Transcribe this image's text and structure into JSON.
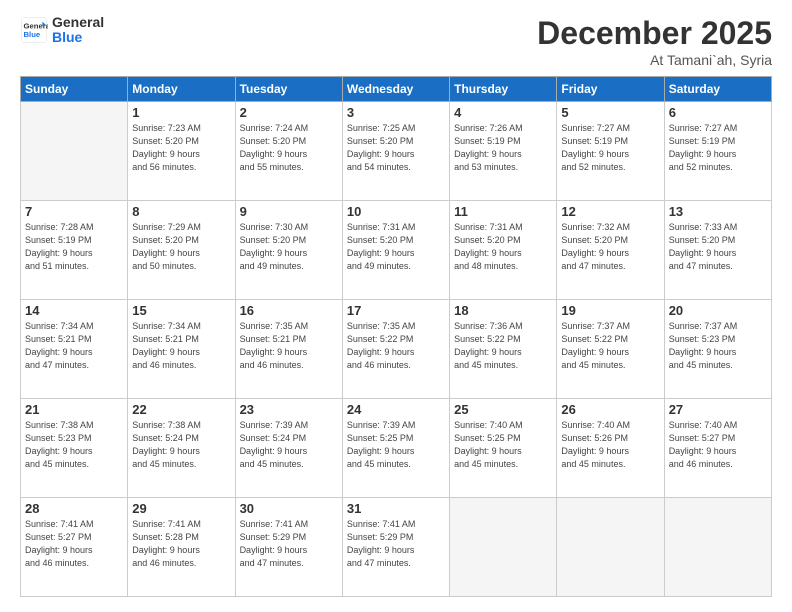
{
  "header": {
    "logo_general": "General",
    "logo_blue": "Blue",
    "month_title": "December 2025",
    "location": "At Tamani`ah, Syria"
  },
  "days_of_week": [
    "Sunday",
    "Monday",
    "Tuesday",
    "Wednesday",
    "Thursday",
    "Friday",
    "Saturday"
  ],
  "weeks": [
    [
      {
        "day": "",
        "info": ""
      },
      {
        "day": "1",
        "info": "Sunrise: 7:23 AM\nSunset: 5:20 PM\nDaylight: 9 hours\nand 56 minutes."
      },
      {
        "day": "2",
        "info": "Sunrise: 7:24 AM\nSunset: 5:20 PM\nDaylight: 9 hours\nand 55 minutes."
      },
      {
        "day": "3",
        "info": "Sunrise: 7:25 AM\nSunset: 5:20 PM\nDaylight: 9 hours\nand 54 minutes."
      },
      {
        "day": "4",
        "info": "Sunrise: 7:26 AM\nSunset: 5:19 PM\nDaylight: 9 hours\nand 53 minutes."
      },
      {
        "day": "5",
        "info": "Sunrise: 7:27 AM\nSunset: 5:19 PM\nDaylight: 9 hours\nand 52 minutes."
      },
      {
        "day": "6",
        "info": "Sunrise: 7:27 AM\nSunset: 5:19 PM\nDaylight: 9 hours\nand 52 minutes."
      }
    ],
    [
      {
        "day": "7",
        "info": "Sunrise: 7:28 AM\nSunset: 5:19 PM\nDaylight: 9 hours\nand 51 minutes."
      },
      {
        "day": "8",
        "info": "Sunrise: 7:29 AM\nSunset: 5:20 PM\nDaylight: 9 hours\nand 50 minutes."
      },
      {
        "day": "9",
        "info": "Sunrise: 7:30 AM\nSunset: 5:20 PM\nDaylight: 9 hours\nand 49 minutes."
      },
      {
        "day": "10",
        "info": "Sunrise: 7:31 AM\nSunset: 5:20 PM\nDaylight: 9 hours\nand 49 minutes."
      },
      {
        "day": "11",
        "info": "Sunrise: 7:31 AM\nSunset: 5:20 PM\nDaylight: 9 hours\nand 48 minutes."
      },
      {
        "day": "12",
        "info": "Sunrise: 7:32 AM\nSunset: 5:20 PM\nDaylight: 9 hours\nand 47 minutes."
      },
      {
        "day": "13",
        "info": "Sunrise: 7:33 AM\nSunset: 5:20 PM\nDaylight: 9 hours\nand 47 minutes."
      }
    ],
    [
      {
        "day": "14",
        "info": "Sunrise: 7:34 AM\nSunset: 5:21 PM\nDaylight: 9 hours\nand 47 minutes."
      },
      {
        "day": "15",
        "info": "Sunrise: 7:34 AM\nSunset: 5:21 PM\nDaylight: 9 hours\nand 46 minutes."
      },
      {
        "day": "16",
        "info": "Sunrise: 7:35 AM\nSunset: 5:21 PM\nDaylight: 9 hours\nand 46 minutes."
      },
      {
        "day": "17",
        "info": "Sunrise: 7:35 AM\nSunset: 5:22 PM\nDaylight: 9 hours\nand 46 minutes."
      },
      {
        "day": "18",
        "info": "Sunrise: 7:36 AM\nSunset: 5:22 PM\nDaylight: 9 hours\nand 45 minutes."
      },
      {
        "day": "19",
        "info": "Sunrise: 7:37 AM\nSunset: 5:22 PM\nDaylight: 9 hours\nand 45 minutes."
      },
      {
        "day": "20",
        "info": "Sunrise: 7:37 AM\nSunset: 5:23 PM\nDaylight: 9 hours\nand 45 minutes."
      }
    ],
    [
      {
        "day": "21",
        "info": "Sunrise: 7:38 AM\nSunset: 5:23 PM\nDaylight: 9 hours\nand 45 minutes."
      },
      {
        "day": "22",
        "info": "Sunrise: 7:38 AM\nSunset: 5:24 PM\nDaylight: 9 hours\nand 45 minutes."
      },
      {
        "day": "23",
        "info": "Sunrise: 7:39 AM\nSunset: 5:24 PM\nDaylight: 9 hours\nand 45 minutes."
      },
      {
        "day": "24",
        "info": "Sunrise: 7:39 AM\nSunset: 5:25 PM\nDaylight: 9 hours\nand 45 minutes."
      },
      {
        "day": "25",
        "info": "Sunrise: 7:40 AM\nSunset: 5:25 PM\nDaylight: 9 hours\nand 45 minutes."
      },
      {
        "day": "26",
        "info": "Sunrise: 7:40 AM\nSunset: 5:26 PM\nDaylight: 9 hours\nand 45 minutes."
      },
      {
        "day": "27",
        "info": "Sunrise: 7:40 AM\nSunset: 5:27 PM\nDaylight: 9 hours\nand 46 minutes."
      }
    ],
    [
      {
        "day": "28",
        "info": "Sunrise: 7:41 AM\nSunset: 5:27 PM\nDaylight: 9 hours\nand 46 minutes."
      },
      {
        "day": "29",
        "info": "Sunrise: 7:41 AM\nSunset: 5:28 PM\nDaylight: 9 hours\nand 46 minutes."
      },
      {
        "day": "30",
        "info": "Sunrise: 7:41 AM\nSunset: 5:29 PM\nDaylight: 9 hours\nand 47 minutes."
      },
      {
        "day": "31",
        "info": "Sunrise: 7:41 AM\nSunset: 5:29 PM\nDaylight: 9 hours\nand 47 minutes."
      },
      {
        "day": "",
        "info": ""
      },
      {
        "day": "",
        "info": ""
      },
      {
        "day": "",
        "info": ""
      }
    ]
  ]
}
